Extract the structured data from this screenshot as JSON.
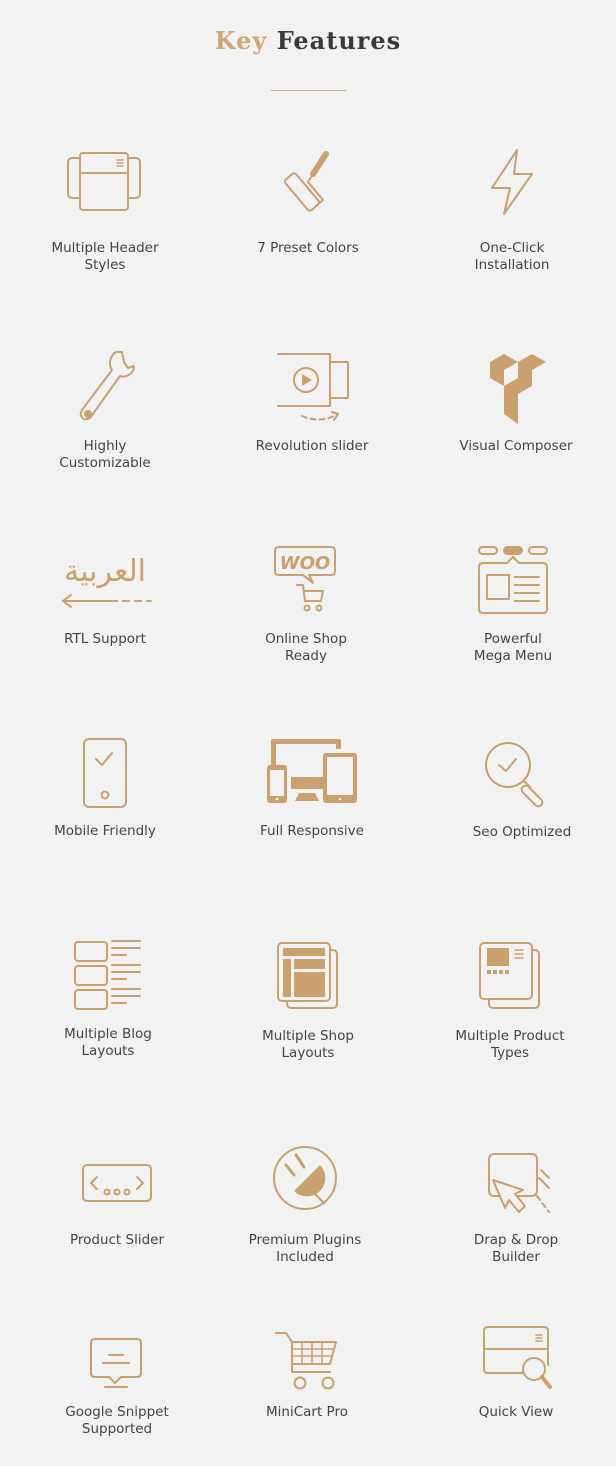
{
  "header": {
    "title_accent": "Key",
    "title_rest": "Features"
  },
  "accent_color": "#d0a874",
  "features": [
    {
      "label": "Multiple Header\nStyles",
      "icon": "header-layout-icon"
    },
    {
      "label": "7 Preset Colors",
      "icon": "paint-roller-icon"
    },
    {
      "label": "One-Click\nInstallation",
      "icon": "lightning-bolt-icon"
    },
    {
      "label": "Highly\nCustomizable",
      "icon": "wrench-icon"
    },
    {
      "label": "Revolution slider",
      "icon": "video-slider-icon"
    },
    {
      "label": "Visual Composer",
      "icon": "visual-composer-logo-icon"
    },
    {
      "label": "RTL Support",
      "icon": "arabic-rtl-icon"
    },
    {
      "label": "Online Shop\nReady",
      "icon": "woocommerce-cart-icon"
    },
    {
      "label": "Powerful\nMega Menu",
      "icon": "mega-menu-icon"
    },
    {
      "label": "Mobile Friendly",
      "icon": "mobile-check-icon"
    },
    {
      "label": "Full Responsive",
      "icon": "responsive-devices-icon"
    },
    {
      "label": "Seo Optimized",
      "icon": "magnifier-check-icon"
    },
    {
      "label": "Multiple Blog\nLayouts",
      "icon": "blog-list-icon"
    },
    {
      "label": "Multiple Shop\nLayouts",
      "icon": "shop-layout-icon"
    },
    {
      "label": "Multiple Product\nTypes",
      "icon": "product-types-icon"
    },
    {
      "label": "Product Slider",
      "icon": "slider-arrows-icon"
    },
    {
      "label": "Premium Plugins\nIncluded",
      "icon": "plug-icon"
    },
    {
      "label": "Drap & Drop\nBuilder",
      "icon": "drag-cursor-icon"
    },
    {
      "label": "Google Snippet\nSupported",
      "icon": "speech-snippet-icon"
    },
    {
      "label": "MiniCart Pro",
      "icon": "shopping-cart-icon"
    },
    {
      "label": "Quick View",
      "icon": "quick-view-icon"
    }
  ],
  "rtl_text": "العربية"
}
